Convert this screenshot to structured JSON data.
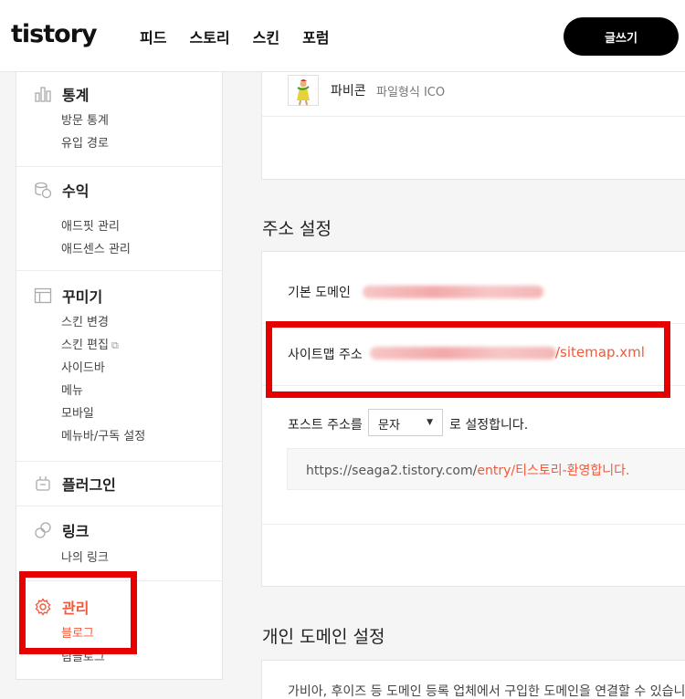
{
  "header": {
    "logo": "tistory",
    "nav": [
      "피드",
      "스토리",
      "스킨",
      "포럼"
    ],
    "write_button": "글쓰기"
  },
  "sidebar": {
    "stats": {
      "title": "통계",
      "items": [
        "방문 통계",
        "유입 경로"
      ]
    },
    "revenue": {
      "title": "수익",
      "items": [
        "애드핏 관리",
        "애드센스 관리"
      ]
    },
    "decorate": {
      "title": "꾸미기",
      "items": [
        "스킨 변경",
        "스킨 편집",
        "사이드바",
        "메뉴",
        "모바일",
        "메뉴바/구독 설정"
      ]
    },
    "plugin": {
      "title": "플러그인"
    },
    "link": {
      "title": "링크",
      "items": [
        "나의 링크"
      ]
    },
    "manage": {
      "title": "관리",
      "items": [
        "블로그",
        "팀블로그"
      ]
    }
  },
  "favicon": {
    "label": "파비콘",
    "desc": "파일형식 ICO"
  },
  "address": {
    "heading": "주소 설정",
    "base_domain_label": "기본 도메인",
    "sitemap_label": "사이트맵 주소",
    "sitemap_suffix": "/sitemap.xml",
    "post_addr_label": "포스트 주소를",
    "post_addr_value": "문자",
    "post_addr_suffix": "로 설정합니다.",
    "example_base": "https://seaga2.tistory.com/",
    "example_entry": "entry/",
    "example_slug": "티스토리-환영합니다."
  },
  "domain": {
    "heading": "개인 도메인 설정",
    "desc": "가비아, 후이즈 등 도메인 등록 업체에서 구입한 도메인을 연결할 수 있습니다."
  },
  "colors": {
    "accent": "#ef5a3a",
    "highlight": "#e60000"
  }
}
